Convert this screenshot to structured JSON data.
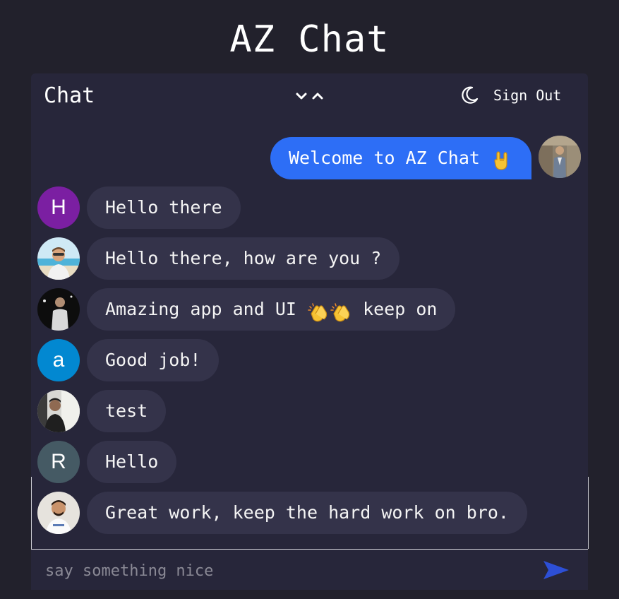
{
  "app": {
    "title": "AZ Chat"
  },
  "header": {
    "title": "Chat",
    "sign_out_label": "Sign Out",
    "icons": [
      "chevron-down-icon",
      "chevron-up-icon",
      "moon-icon"
    ]
  },
  "sent_message": {
    "text": "Welcome to AZ Chat",
    "emoji": "rock-on-hand-emoji",
    "bubble_color": "#2d6ef6"
  },
  "messages": [
    {
      "avatar_letter": "H",
      "avatar_color": "#7b1fa2",
      "text": "Hello there"
    },
    {
      "avatar_letter": "",
      "avatar_photo": "beach-portrait",
      "text": "Hello there, how are you ?"
    },
    {
      "avatar_letter": "",
      "avatar_photo": "dark-portrait",
      "text": "Amazing app and UI",
      "emoji": "clapping-hands-emoji",
      "text_after": "keep on"
    },
    {
      "avatar_letter": "a",
      "avatar_color": "#0288d1",
      "text": "Good job!"
    },
    {
      "avatar_letter": "",
      "avatar_photo": "mirror-selfie",
      "text": "test"
    },
    {
      "avatar_letter": "R",
      "avatar_color": "#455a64",
      "text": "Hello"
    },
    {
      "avatar_letter": "",
      "avatar_photo": "smiling-portrait",
      "text": "Great work, keep the hard work on bro."
    }
  ],
  "composer": {
    "placeholder": "say something nice",
    "value": "",
    "send_icon": "send-icon",
    "send_color": "#2d4fd6"
  },
  "colors": {
    "background": "#22212c",
    "panel": "#27263a",
    "received_bubble": "#34334a"
  }
}
